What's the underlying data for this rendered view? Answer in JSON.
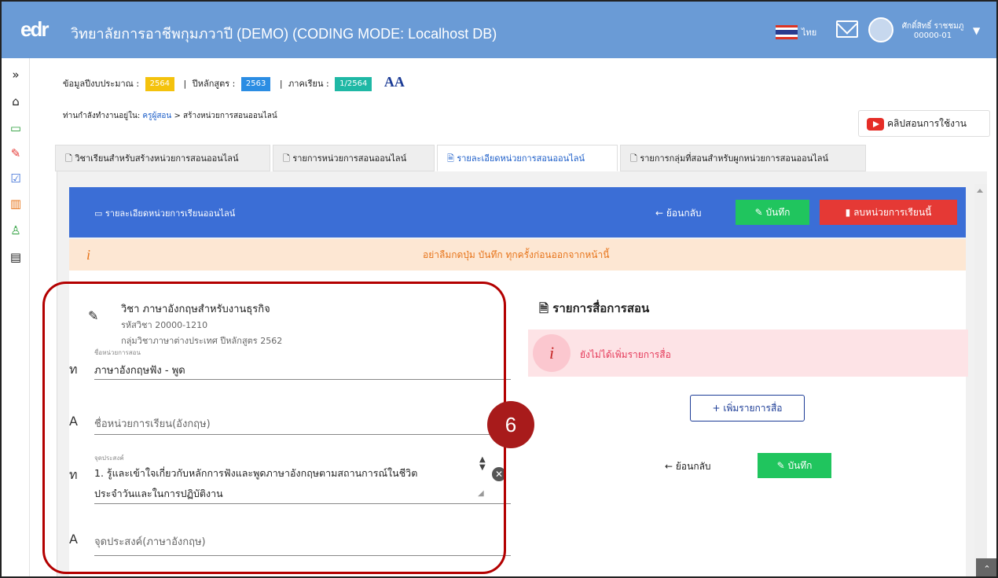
{
  "app": {
    "title": "วิทยาลัยการอาชีพกุมภวาปี (DEMO) (CODING MODE: Localhost DB)",
    "logo": "edr",
    "language": "ไทย",
    "user_name": "ศักดิ์สิทธิ์ ราชชมภู",
    "user_id": "00000-01"
  },
  "infobar": {
    "budget_label": "ข้อมูลปีงบประมาณ :",
    "budget_value": "2564",
    "curriculum_label": "ปีหลักสูตร :",
    "curriculum_value": "2563",
    "term_label": "ภาคเรียน :",
    "term_value": "1/2564",
    "font_size_toggle": "AA"
  },
  "breadcrumb": {
    "prefix": "ท่านกำลังทำงานอยู่ใน:",
    "link": "ครูผู้สอน",
    "current": "> สร้างหน่วยการสอนออนไลน์"
  },
  "help_button": "คลิปสอนการใช้งาน",
  "tabs": [
    {
      "label": "วิชาเรียนสำหรับสร้างหน่วยการสอนออนไลน์"
    },
    {
      "label": "รายการหน่วยการสอนออนไลน์"
    },
    {
      "label": "รายละเอียดหน่วยการสอนออนไลน์"
    },
    {
      "label": "รายการกลุ่มที่สอนสำหรับผูกหน่วยการสอนออนไลน์"
    }
  ],
  "header": {
    "title": "รายละเอียดหน่วยการเรียนออนไลน์",
    "back": "ย้อนกลับ",
    "save": "บันทึก",
    "delete": "ลบหน่วยการเรียนนี้"
  },
  "warning": "อย่าลืมกดปุ่ม บันทึก ทุกครั้งก่อนออกจากหน้านี้",
  "subject": {
    "name": "วิชา ภาษาอังกฤษสำหรับงานธุรกิจ",
    "code": "รหัสวิชา 20000-1210",
    "group": "กลุ่มวิชาภาษาต่างประเทศ ปีหลักสูตร 2562"
  },
  "form": {
    "unit_label": "ชื่อหน่วยการสอน",
    "unit_value": "ภาษาอังกฤษฟัง - พูด",
    "unit_en_placeholder": "ชื่อหน่วยการเรียน(อังกฤษ)",
    "objective_label": "จุดประสงค์",
    "objective_line1": "1. รู้และเข้าใจเกี่ยวกับหลักการฟังและพูดภาษาอังกฤษตามสถานการณ์ในชีวิต",
    "objective_line2": "ประจำวันและในการปฏิบัติงาน",
    "objective_en_placeholder": "จุดประสงค์(ภาษาอังกฤษ)"
  },
  "media": {
    "title": "รายการสื่อการสอน",
    "empty": "ยังไม่ได้เพิ่มรายการสื่อ",
    "add": "+ เพิ่มรายการสื่อ",
    "back": "ย้อนกลับ",
    "save": "บันทึก"
  },
  "annotation": {
    "step": "6"
  },
  "colors": {
    "topbar": "#6a9bd6",
    "header": "#3b6ed6",
    "save": "#20c55e",
    "delete": "#e53935",
    "highlight": "#b30000"
  }
}
